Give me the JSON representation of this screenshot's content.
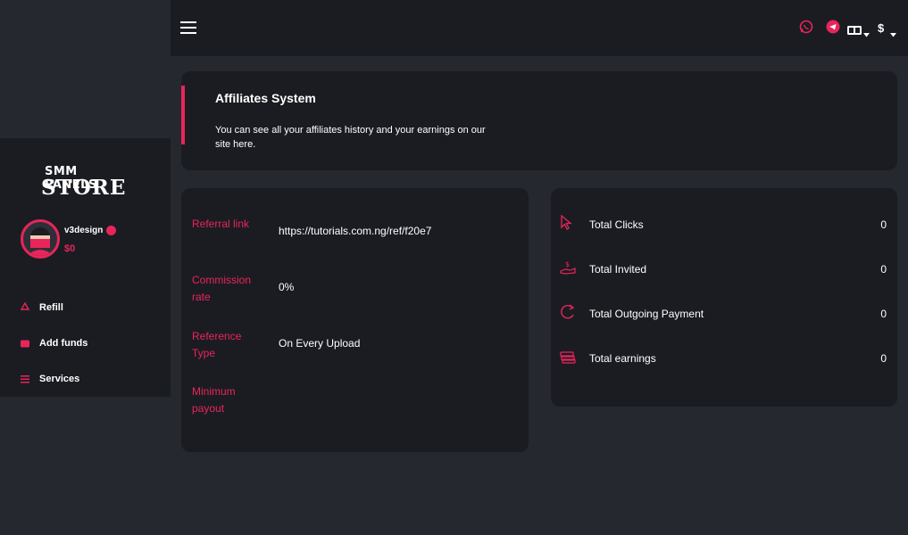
{
  "colors": {
    "accent": "#e8255a",
    "card": "#1b1c22",
    "background": "#262830"
  },
  "sidebar": {
    "logo_line1": "SMM PANELS",
    "logo_line2": "STORE",
    "username": "v3design",
    "balance": "$0",
    "items": [
      {
        "label": "Refill",
        "icon": "recycle-icon"
      },
      {
        "label": "Add funds",
        "icon": "wallet-icon"
      },
      {
        "label": "Services",
        "icon": "list-icon"
      }
    ]
  },
  "topbar": {
    "language_label": "AB",
    "currency_label": "$"
  },
  "hero": {
    "title": "Affiliates System",
    "description": "You can see all your affiliates history and your earnings on our site here."
  },
  "affiliate_info": [
    {
      "label": "Referral link",
      "value": "https://tutorials.com.ng/ref/f20e7"
    },
    {
      "label": "Commission rate",
      "value": "0%"
    },
    {
      "label": "Reference Type",
      "value": "On Every Upload"
    },
    {
      "label": "Minimum payout",
      "value": ""
    }
  ],
  "stats": [
    {
      "label": "Total Clicks",
      "value": "0",
      "icon": "cursor-icon"
    },
    {
      "label": "Total Invited",
      "value": "0",
      "icon": "money-hand-icon"
    },
    {
      "label": "Total Outgoing Payment",
      "value": "0",
      "icon": "refresh-icon"
    },
    {
      "label": "Total earnings",
      "value": "0",
      "icon": "cash-stack-icon"
    }
  ]
}
